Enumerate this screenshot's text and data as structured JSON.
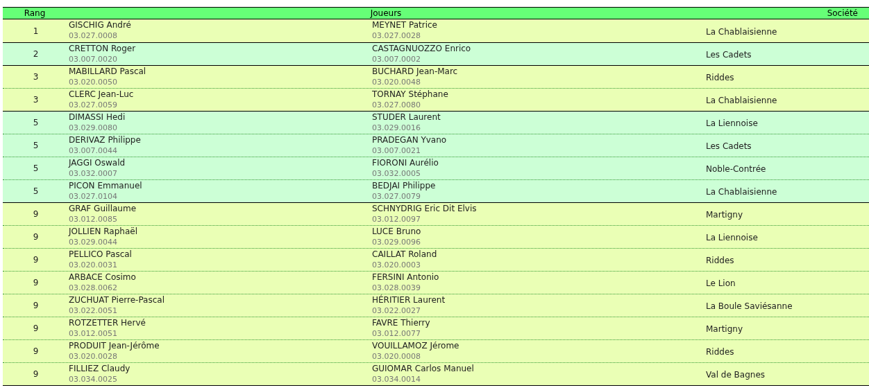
{
  "table": {
    "columns": [
      "Rang",
      "Joueurs",
      "Société"
    ],
    "groups": [
      {
        "rows": [
          {
            "rank": "1",
            "player_1": {
              "name": "GISCHIG André",
              "licence": "03.027.0008"
            },
            "player_2": {
              "name": "MEYNET Patrice",
              "licence": "03.027.0028"
            },
            "club": "La Chablaisienne"
          }
        ]
      },
      {
        "rows": [
          {
            "rank": "2",
            "player_1": {
              "name": "CRETTON Roger",
              "licence": "03.007.0020"
            },
            "player_2": {
              "name": "CASTAGNUOZZO Enrico",
              "licence": "03.007.0002"
            },
            "club": "Les Cadets"
          }
        ]
      },
      {
        "rows": [
          {
            "rank": "3",
            "player_1": {
              "name": "MABILLARD Pascal",
              "licence": "03.020.0050"
            },
            "player_2": {
              "name": "BUCHARD Jean-Marc",
              "licence": "03.020.0048"
            },
            "club": "Riddes"
          },
          {
            "rank": "3",
            "player_1": {
              "name": "CLERC Jean-Luc",
              "licence": "03.027.0059"
            },
            "player_2": {
              "name": "TORNAY Stéphane",
              "licence": "03.027.0080"
            },
            "club": "La Chablaisienne"
          }
        ]
      },
      {
        "rows": [
          {
            "rank": "5",
            "player_1": {
              "name": "DIMASSI Hedi",
              "licence": "03.029.0080"
            },
            "player_2": {
              "name": "STUDER Laurent",
              "licence": "03.029.0016"
            },
            "club": "La Liennoise"
          },
          {
            "rank": "5",
            "player_1": {
              "name": "DERIVAZ Philippe",
              "licence": "03.007.0044"
            },
            "player_2": {
              "name": "PRADEGAN Yvano",
              "licence": "03.007.0021"
            },
            "club": "Les Cadets"
          },
          {
            "rank": "5",
            "player_1": {
              "name": "JAGGI Oswald",
              "licence": "03.032.0007"
            },
            "player_2": {
              "name": "FIORONI Aurélio",
              "licence": "03.032.0005"
            },
            "club": "Noble-Contrée"
          },
          {
            "rank": "5",
            "player_1": {
              "name": "PICON Emmanuel",
              "licence": "03.027.0104"
            },
            "player_2": {
              "name": "BEDJAI Philippe",
              "licence": "03.027.0079"
            },
            "club": "La Chablaisienne"
          }
        ]
      },
      {
        "rows": [
          {
            "rank": "9",
            "player_1": {
              "name": "GRAF Guillaume",
              "licence": "03.012.0085"
            },
            "player_2": {
              "name": "SCHNYDRIG Eric Dit Elvis",
              "licence": "03.012.0097"
            },
            "club": "Martigny"
          },
          {
            "rank": "9",
            "player_1": {
              "name": "JOLLIEN Raphaël",
              "licence": "03.029.0044"
            },
            "player_2": {
              "name": "LUCE Bruno",
              "licence": "03.029.0096"
            },
            "club": "La Liennoise"
          },
          {
            "rank": "9",
            "player_1": {
              "name": "PELLICO Pascal",
              "licence": "03.020.0031"
            },
            "player_2": {
              "name": "CAILLAT Roland",
              "licence": "03.020.0003"
            },
            "club": "Riddes"
          },
          {
            "rank": "9",
            "player_1": {
              "name": "ARBACE Cosimo",
              "licence": "03.028.0062"
            },
            "player_2": {
              "name": "FERSINI Antonio",
              "licence": "03.028.0039"
            },
            "club": "Le Lion"
          },
          {
            "rank": "9",
            "player_1": {
              "name": "ZUCHUAT Pierre-Pascal",
              "licence": "03.022.0051"
            },
            "player_2": {
              "name": "HÉRITIER Laurent",
              "licence": "03.022.0027"
            },
            "club": "La Boule Saviésanne"
          },
          {
            "rank": "9",
            "player_1": {
              "name": "ROTZETTER Hervé",
              "licence": "03.012.0051"
            },
            "player_2": {
              "name": "FAVRE Thierry",
              "licence": "03.012.0077"
            },
            "club": "Martigny"
          },
          {
            "rank": "9",
            "player_1": {
              "name": "PRODUIT Jean-Jérôme",
              "licence": "03.020.0028"
            },
            "player_2": {
              "name": "VOUILLAMOZ Jérome",
              "licence": "03.020.0008"
            },
            "club": "Riddes"
          },
          {
            "rank": "9",
            "player_1": {
              "name": "FILLIEZ Claudy",
              "licence": "03.034.0025"
            },
            "player_2": {
              "name": "GUIOMAR Carlos Manuel",
              "licence": "03.034.0014"
            },
            "club": "Val de Bagnes"
          }
        ]
      }
    ]
  }
}
